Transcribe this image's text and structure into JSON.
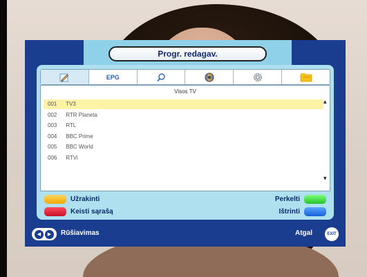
{
  "menu": {
    "title": "Progr. redagav.",
    "tabs": [
      {
        "label": "",
        "icon": "pencil-icon",
        "active": true
      },
      {
        "label": "EPG",
        "icon": "epg-icon",
        "active": false
      },
      {
        "label": "",
        "icon": "search-icon",
        "active": false
      },
      {
        "label": "",
        "icon": "satellite-icon",
        "active": false
      },
      {
        "label": "",
        "icon": "gear-icon",
        "active": false
      },
      {
        "label": "",
        "icon": "folder-icon",
        "active": false
      }
    ],
    "list_title": "Visos TV",
    "channels": [
      {
        "num": "001",
        "name": "TV3",
        "selected": true
      },
      {
        "num": "002",
        "name": "RTR Planeta",
        "selected": false
      },
      {
        "num": "003",
        "name": "RTL",
        "selected": false
      },
      {
        "num": "004",
        "name": "BBC Prime",
        "selected": false
      },
      {
        "num": "005",
        "name": "BBC World",
        "selected": false
      },
      {
        "num": "006",
        "name": "RTVi",
        "selected": false
      }
    ],
    "color_keys": {
      "yellow": "Užrakinti",
      "red": "Keisti sąrašą",
      "green": "Perkelti",
      "blue": "Ištrinti"
    },
    "bottom": {
      "left_hint": "Rūšiavimas",
      "right_hint": "Atgal",
      "exit_label": "EXIT"
    }
  },
  "colors": {
    "panel_blue": "#1a3d8f",
    "panel_light": "#aee0ef",
    "title_area": "#8fd1e8",
    "selected_row": "#fdf3a7",
    "key_yellow": "#f2a800",
    "key_red": "#c8102e",
    "key_green": "#25c325",
    "key_blue": "#1560d8"
  }
}
